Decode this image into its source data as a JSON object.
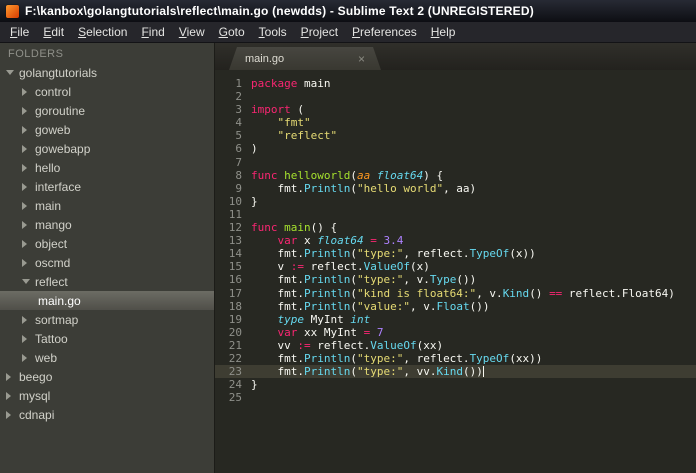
{
  "window": {
    "title": "F:\\kanbox\\golangtutorials\\reflect\\main.go (newdds) - Sublime Text 2 (UNREGISTERED)"
  },
  "menu": {
    "items": [
      "File",
      "Edit",
      "Selection",
      "Find",
      "View",
      "Goto",
      "Tools",
      "Project",
      "Preferences",
      "Help"
    ]
  },
  "sidebar": {
    "header": "FOLDERS",
    "items": [
      {
        "label": "golangtutorials",
        "depth": 0,
        "state": "expanded"
      },
      {
        "label": "control",
        "depth": 1,
        "state": "collapsed"
      },
      {
        "label": "goroutine",
        "depth": 1,
        "state": "collapsed"
      },
      {
        "label": "goweb",
        "depth": 1,
        "state": "collapsed"
      },
      {
        "label": "gowebapp",
        "depth": 1,
        "state": "collapsed"
      },
      {
        "label": "hello",
        "depth": 1,
        "state": "collapsed"
      },
      {
        "label": "interface",
        "depth": 1,
        "state": "collapsed"
      },
      {
        "label": "main",
        "depth": 1,
        "state": "collapsed"
      },
      {
        "label": "mango",
        "depth": 1,
        "state": "collapsed"
      },
      {
        "label": "object",
        "depth": 1,
        "state": "collapsed"
      },
      {
        "label": "oscmd",
        "depth": 1,
        "state": "collapsed"
      },
      {
        "label": "reflect",
        "depth": 1,
        "state": "expanded"
      },
      {
        "label": "main.go",
        "depth": 2,
        "state": "file",
        "selected": true
      },
      {
        "label": "sortmap",
        "depth": 1,
        "state": "collapsed"
      },
      {
        "label": "Tattoo",
        "depth": 1,
        "state": "collapsed"
      },
      {
        "label": "web",
        "depth": 1,
        "state": "collapsed"
      },
      {
        "label": "beego",
        "depth": 0,
        "state": "collapsed"
      },
      {
        "label": "mysql",
        "depth": 0,
        "state": "collapsed"
      },
      {
        "label": "cdnapi",
        "depth": 0,
        "state": "collapsed"
      }
    ]
  },
  "tab": {
    "label": "main.go",
    "close_icon": "×"
  },
  "icons": {
    "app_icon": "sublime-logo",
    "folder_expanded": "chevron-down",
    "folder_collapsed": "chevron-right",
    "tab_close": "×"
  },
  "colors": {
    "editor_bg": "#272822",
    "sidebar_bg": "#3c3d37",
    "tab_active_bg": "#403f39",
    "selected_item_bg": "#5b5b54",
    "active_line_bg": "#3e3d32",
    "keyword": "#f92672",
    "string": "#e6db74",
    "number": "#ae81ff",
    "function_name": "#a6e22e",
    "type": "#66d9ef",
    "parameter": "#fd971f",
    "text": "#f8f8f2",
    "line_number": "#8f908a"
  },
  "editor": {
    "lines": [
      {
        "num": 1,
        "tokens": [
          [
            "kw",
            "package"
          ],
          [
            "pl",
            " main"
          ]
        ]
      },
      {
        "num": 2,
        "tokens": []
      },
      {
        "num": 3,
        "tokens": [
          [
            "kw",
            "import"
          ],
          [
            "pl",
            " ("
          ]
        ]
      },
      {
        "num": 4,
        "tokens": [
          [
            "pl",
            "    "
          ],
          [
            "st",
            "\"fmt\""
          ]
        ]
      },
      {
        "num": 5,
        "tokens": [
          [
            "pl",
            "    "
          ],
          [
            "st",
            "\"reflect\""
          ]
        ]
      },
      {
        "num": 6,
        "tokens": [
          [
            "pl",
            ")"
          ]
        ]
      },
      {
        "num": 7,
        "tokens": []
      },
      {
        "num": 8,
        "tokens": [
          [
            "kw",
            "func"
          ],
          [
            "fn",
            " helloworld"
          ],
          [
            "pl",
            "("
          ],
          [
            "pa",
            "aa"
          ],
          [
            "pl",
            " "
          ],
          [
            "ty",
            "float64"
          ],
          [
            "pl",
            ") {"
          ]
        ]
      },
      {
        "num": 9,
        "tokens": [
          [
            "pl",
            "    fmt."
          ],
          [
            "su",
            "Println"
          ],
          [
            "pl",
            "("
          ],
          [
            "st",
            "\"hello world\""
          ],
          [
            "pl",
            ", aa)"
          ]
        ]
      },
      {
        "num": 10,
        "tokens": [
          [
            "pl",
            "}"
          ]
        ]
      },
      {
        "num": 11,
        "tokens": []
      },
      {
        "num": 12,
        "tokens": [
          [
            "kw",
            "func"
          ],
          [
            "fn",
            " main"
          ],
          [
            "pl",
            "() {"
          ]
        ]
      },
      {
        "num": 13,
        "tokens": [
          [
            "pl",
            "    "
          ],
          [
            "kw",
            "var"
          ],
          [
            "pl",
            " x "
          ],
          [
            "ty",
            "float64"
          ],
          [
            "pl",
            " "
          ],
          [
            "kw",
            "="
          ],
          [
            "pl",
            " "
          ],
          [
            "nu",
            "3.4"
          ]
        ]
      },
      {
        "num": 14,
        "tokens": [
          [
            "pl",
            "    fmt."
          ],
          [
            "su",
            "Println"
          ],
          [
            "pl",
            "("
          ],
          [
            "st",
            "\"type:\""
          ],
          [
            "pl",
            ", reflect."
          ],
          [
            "su",
            "TypeOf"
          ],
          [
            "pl",
            "(x))"
          ]
        ]
      },
      {
        "num": 15,
        "tokens": [
          [
            "pl",
            "    v "
          ],
          [
            "kw",
            ":="
          ],
          [
            "pl",
            " reflect."
          ],
          [
            "su",
            "ValueOf"
          ],
          [
            "pl",
            "(x)"
          ]
        ]
      },
      {
        "num": 16,
        "tokens": [
          [
            "pl",
            "    fmt."
          ],
          [
            "su",
            "Println"
          ],
          [
            "pl",
            "("
          ],
          [
            "st",
            "\"type:\""
          ],
          [
            "pl",
            ", v."
          ],
          [
            "su",
            "Type"
          ],
          [
            "pl",
            "())"
          ]
        ]
      },
      {
        "num": 17,
        "tokens": [
          [
            "pl",
            "    fmt."
          ],
          [
            "su",
            "Println"
          ],
          [
            "pl",
            "("
          ],
          [
            "st",
            "\"kind is float64:\""
          ],
          [
            "pl",
            ", v."
          ],
          [
            "su",
            "Kind"
          ],
          [
            "pl",
            "() "
          ],
          [
            "kw",
            "=="
          ],
          [
            "pl",
            " reflect.Float64)"
          ]
        ]
      },
      {
        "num": 18,
        "tokens": [
          [
            "pl",
            "    fmt."
          ],
          [
            "su",
            "Println"
          ],
          [
            "pl",
            "("
          ],
          [
            "st",
            "\"value:\""
          ],
          [
            "pl",
            ", v."
          ],
          [
            "su",
            "Float"
          ],
          [
            "pl",
            "())"
          ]
        ]
      },
      {
        "num": 19,
        "tokens": [
          [
            "pl",
            "    "
          ],
          [
            "ty",
            "type"
          ],
          [
            "pl",
            " MyInt "
          ],
          [
            "ty",
            "int"
          ]
        ]
      },
      {
        "num": 20,
        "tokens": [
          [
            "pl",
            "    "
          ],
          [
            "kw",
            "var"
          ],
          [
            "pl",
            " xx MyInt "
          ],
          [
            "kw",
            "="
          ],
          [
            "pl",
            " "
          ],
          [
            "nu",
            "7"
          ]
        ]
      },
      {
        "num": 21,
        "tokens": [
          [
            "pl",
            "    vv "
          ],
          [
            "kw",
            ":="
          ],
          [
            "pl",
            " reflect."
          ],
          [
            "su",
            "ValueOf"
          ],
          [
            "pl",
            "(xx)"
          ]
        ]
      },
      {
        "num": 22,
        "tokens": [
          [
            "pl",
            "    fmt."
          ],
          [
            "su",
            "Println"
          ],
          [
            "pl",
            "("
          ],
          [
            "st",
            "\"type:\""
          ],
          [
            "pl",
            ", reflect."
          ],
          [
            "su",
            "TypeOf"
          ],
          [
            "pl",
            "(xx))"
          ]
        ]
      },
      {
        "num": 23,
        "active": true,
        "cursor": true,
        "tokens": [
          [
            "pl",
            "    fmt."
          ],
          [
            "su",
            "Println"
          ],
          [
            "pl",
            "("
          ],
          [
            "st",
            "\"type:\""
          ],
          [
            "pl",
            ", vv."
          ],
          [
            "su",
            "Kind"
          ],
          [
            "pl",
            "())"
          ]
        ]
      },
      {
        "num": 24,
        "tokens": [
          [
            "pl",
            "}"
          ]
        ]
      },
      {
        "num": 25,
        "tokens": []
      }
    ]
  }
}
